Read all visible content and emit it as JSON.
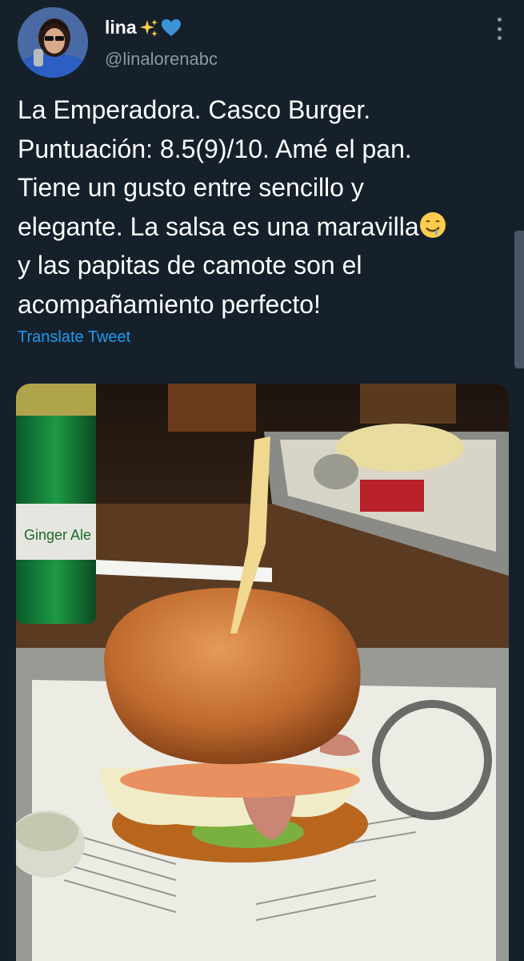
{
  "author": {
    "display_name": "lina",
    "name_emojis": [
      "sparkles-emoji",
      "blue-heart-emoji"
    ],
    "handle": "@linalorenabc"
  },
  "tweet": {
    "lines": [
      "La Emperadora. Casco Burger.",
      "Puntuación: 8.5(9)/10. Amé el pan.",
      "Tiene un gusto entre sencillo y",
      "elegante. La salsa es una maravilla",
      "y las papitas de camote son el",
      "acompañamiento perfecto!"
    ],
    "inline_emoji": "drooling-face-emoji",
    "translate_label": "Translate Tweet"
  },
  "colors": {
    "background": "#15202b",
    "secondary_text": "#8b98a5",
    "link": "#1d9bf0"
  },
  "media": {
    "kind": "photo",
    "subject": "burger-on-tray-icon"
  }
}
